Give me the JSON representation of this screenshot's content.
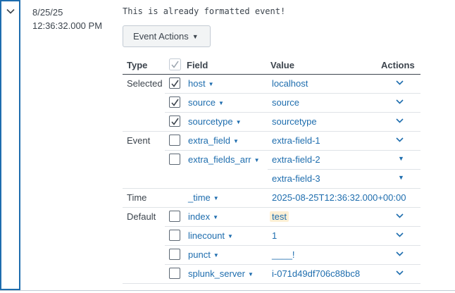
{
  "event": {
    "date": "8/25/25",
    "time": "12:36:32.000 PM",
    "raw": "This is already formatted event!",
    "actions_button": "Event Actions",
    "caret_icon": "triangle-down-icon",
    "expand_icon": "chevron-down-icon"
  },
  "headers": {
    "type": "Type",
    "field": "Field",
    "value": "Value",
    "actions": "Actions"
  },
  "rows": [
    {
      "group": "Selected",
      "checked": true,
      "field": "host",
      "value": "localhost",
      "action_icon": "chevron-down-icon"
    },
    {
      "group": "",
      "checked": true,
      "field": "source",
      "value": "source",
      "action_icon": "chevron-down-icon"
    },
    {
      "group": "",
      "checked": true,
      "field": "sourcetype",
      "value": "sourcetype",
      "action_icon": "chevron-down-icon"
    },
    {
      "group": "Event",
      "checked": false,
      "field": "extra_field",
      "value": "extra-field-1",
      "action_icon": "chevron-down-icon"
    },
    {
      "group": "",
      "checked": false,
      "field": "extra_fields_arr",
      "value": "extra-field-2",
      "action_icon": "triangle-down-icon"
    },
    {
      "group": "",
      "checked": null,
      "field": "",
      "value": "extra-field-3",
      "action_icon": "triangle-down-icon"
    },
    {
      "group": "Time",
      "checked": null,
      "field": "_time",
      "value": "2025-08-25T12:36:32.000+00:00",
      "action_icon": ""
    },
    {
      "group": "Default",
      "checked": false,
      "field": "index",
      "value": "test",
      "highlight": true,
      "action_icon": "chevron-down-icon"
    },
    {
      "group": "",
      "checked": false,
      "field": "linecount",
      "value": "1",
      "action_icon": "chevron-down-icon"
    },
    {
      "group": "",
      "checked": false,
      "field": "punct",
      "value": "____!",
      "action_icon": "chevron-down-icon"
    },
    {
      "group": "",
      "checked": false,
      "field": "splunk_server",
      "value": "i-071d49df706c88bc8",
      "action_icon": "chevron-down-icon"
    }
  ],
  "colors": {
    "link": "#1e6dae",
    "text": "#3c444d",
    "highlight": "#fdf0d5",
    "border": "#1e6dae"
  }
}
